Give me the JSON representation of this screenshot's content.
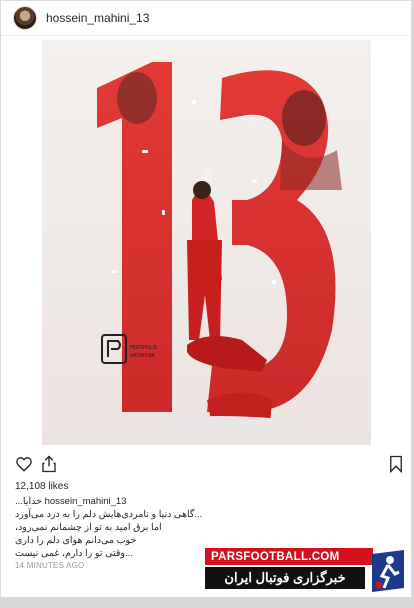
{
  "post": {
    "username": "hossein_mahini_13",
    "likes": "12,108 likes",
    "timestamp": "14 MINUTES AGO",
    "caption_user": "hossein_mahini_13",
    "caption_lines": [
      "خدایا...",
      "...گاهی دنیا و نامردی‌هایش دلم را به درد می‌آورد",
      "اما برق امید به تو از چشمانم نمی‌رود،",
      "خوب می‌دانم هوای دلم را داری",
      "...وقتی تو را دارم، غمی نیست"
    ]
  },
  "image": {
    "big_number": "13",
    "logo_text_1": "PERSPOLIS",
    "logo_text_2": "ARTWORK"
  },
  "watermark": {
    "site": "PARSFOOTBALL.COM",
    "tagline": "خبرگزاری فوتبال ایران"
  },
  "colors": {
    "accent_red": "#d6111d",
    "number_red": "#e2302c"
  },
  "icons": [
    "heart-icon",
    "share-icon",
    "bookmark-icon",
    "perspolis-logo"
  ]
}
